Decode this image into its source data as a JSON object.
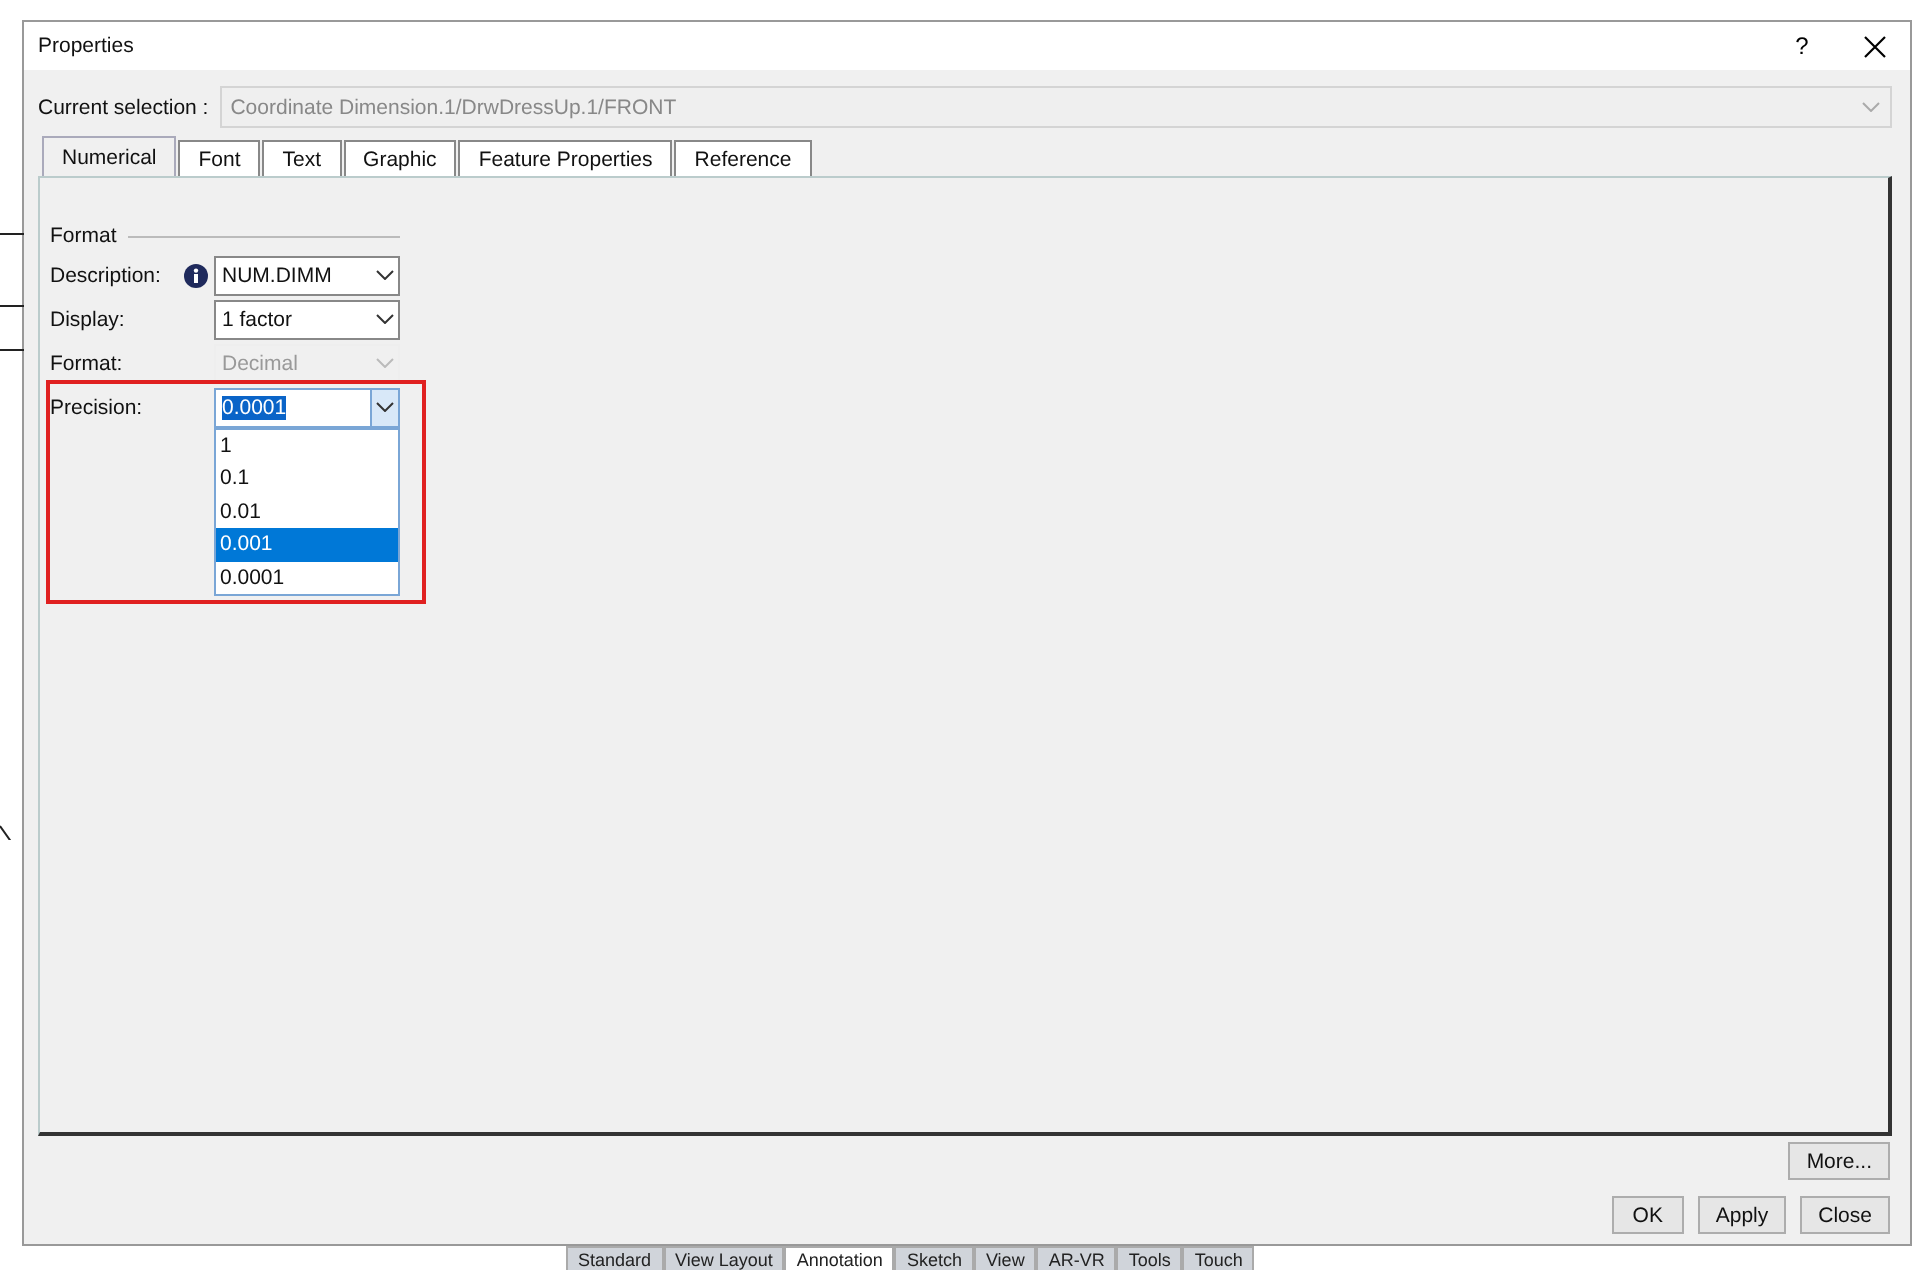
{
  "window": {
    "title": "Properties",
    "help": "?"
  },
  "current_selection": {
    "label": "Current selection :",
    "value": "Coordinate Dimension.1/DrwDressUp.1/FRONT"
  },
  "tabs": [
    {
      "label": "Numerical",
      "selected": true
    },
    {
      "label": "Font",
      "selected": false
    },
    {
      "label": "Text",
      "selected": false
    },
    {
      "label": "Graphic",
      "selected": false
    },
    {
      "label": "Feature Properties",
      "selected": false
    },
    {
      "label": "Reference",
      "selected": false
    }
  ],
  "format_group": {
    "title": "Format",
    "fields": [
      {
        "label": "Description:",
        "value": "NUM.DIMM",
        "info": true,
        "disabled": false,
        "expanded": false
      },
      {
        "label": "Display:",
        "value": "1 factor",
        "info": false,
        "disabled": false,
        "expanded": false
      },
      {
        "label": "Format:",
        "value": "Decimal",
        "info": false,
        "disabled": true,
        "expanded": false
      },
      {
        "label": "Precision:",
        "value": "0.0001",
        "info": false,
        "disabled": false,
        "expanded": true,
        "options": [
          {
            "label": "1",
            "highlighted": false
          },
          {
            "label": "0.1",
            "highlighted": false
          },
          {
            "label": "0.01",
            "highlighted": false
          },
          {
            "label": "0.001",
            "highlighted": true
          },
          {
            "label": "0.0001",
            "highlighted": false
          }
        ]
      }
    ]
  },
  "more_button": "More...",
  "buttons": [
    "OK",
    "Apply",
    "Close"
  ],
  "workbench_tabs": [
    {
      "label": "Standard",
      "selected": false
    },
    {
      "label": "View Layout",
      "selected": false
    },
    {
      "label": "Annotation",
      "selected": true
    },
    {
      "label": "Sketch",
      "selected": false
    },
    {
      "label": "View",
      "selected": false
    },
    {
      "label": "AR-VR",
      "selected": false
    },
    {
      "label": "Tools",
      "selected": false
    },
    {
      "label": "Touch",
      "selected": false
    }
  ]
}
